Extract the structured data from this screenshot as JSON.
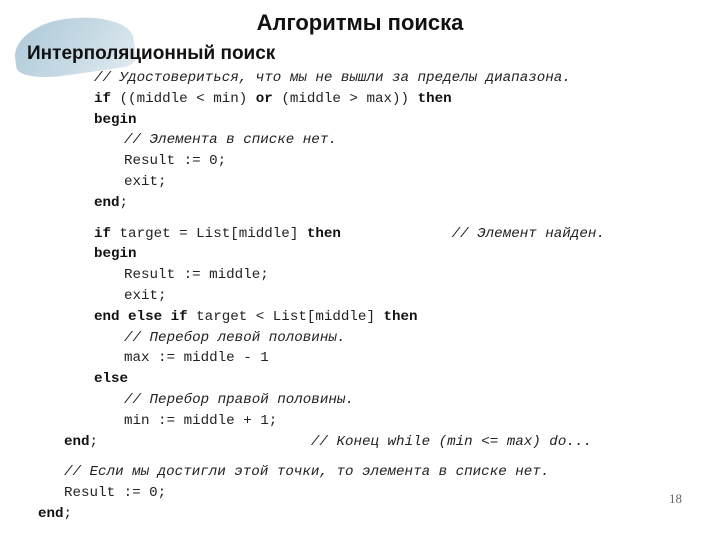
{
  "slide": {
    "title": "Алгоритмы поиска",
    "subtitle": "Интерполяционный поиск",
    "page_number": "18"
  },
  "code": [
    {
      "indent": 1,
      "segments": [
        {
          "t": "cm",
          "v": "// Удостовериться, что мы не вышли за пределы диапазона."
        }
      ]
    },
    {
      "indent": 1,
      "segments": [
        {
          "t": "kw",
          "v": "if"
        },
        {
          "t": "tx",
          "v": " ((middle < min) "
        },
        {
          "t": "kw",
          "v": "or"
        },
        {
          "t": "tx",
          "v": " (middle > max)) "
        },
        {
          "t": "kw",
          "v": "then"
        }
      ]
    },
    {
      "indent": 1,
      "segments": [
        {
          "t": "kw",
          "v": "begin"
        }
      ]
    },
    {
      "indent": 2,
      "segments": [
        {
          "t": "cm",
          "v": "// Элемента в списке нет."
        }
      ]
    },
    {
      "indent": 2,
      "segments": [
        {
          "t": "tx",
          "v": "Result := 0;"
        }
      ]
    },
    {
      "indent": 2,
      "segments": [
        {
          "t": "tx",
          "v": "exit;"
        }
      ]
    },
    {
      "indent": 1,
      "segments": [
        {
          "t": "kw",
          "v": "end"
        },
        {
          "t": "tx",
          "v": ";"
        }
      ]
    },
    {
      "indent": 1,
      "gap": true,
      "segments": [
        {
          "t": "kw",
          "v": "if"
        },
        {
          "t": "tx",
          "v": " target = List[middle] "
        },
        {
          "t": "kw",
          "v": "then"
        },
        {
          "t": "tx",
          "v": "             "
        },
        {
          "t": "cm",
          "v": "// Элемент найден."
        }
      ]
    },
    {
      "indent": 1,
      "segments": [
        {
          "t": "kw",
          "v": "begin"
        }
      ]
    },
    {
      "indent": 2,
      "segments": [
        {
          "t": "tx",
          "v": "Result := middle;"
        }
      ]
    },
    {
      "indent": 2,
      "segments": [
        {
          "t": "tx",
          "v": "exit;"
        }
      ]
    },
    {
      "indent": 1,
      "segments": [
        {
          "t": "kw",
          "v": "end else if"
        },
        {
          "t": "tx",
          "v": " target < List[middle] "
        },
        {
          "t": "kw",
          "v": "then"
        }
      ]
    },
    {
      "indent": 2,
      "segments": [
        {
          "t": "cm",
          "v": "// Перебор левой половины."
        }
      ]
    },
    {
      "indent": 2,
      "segments": [
        {
          "t": "tx",
          "v": "max := middle - 1"
        }
      ]
    },
    {
      "indent": 1,
      "segments": [
        {
          "t": "kw",
          "v": "else"
        }
      ]
    },
    {
      "indent": 2,
      "segments": [
        {
          "t": "cm",
          "v": "// Перебор правой половины."
        }
      ]
    },
    {
      "indent": 2,
      "segments": [
        {
          "t": "tx",
          "v": "min := middle + 1;"
        }
      ]
    },
    {
      "indent": 0,
      "segments": [
        {
          "t": "kw",
          "v": "end"
        },
        {
          "t": "tx",
          "v": ";                         "
        },
        {
          "t": "cm",
          "v": "// Конец while (min <= max) do..."
        }
      ]
    },
    {
      "indent": 0,
      "gap": true,
      "segments": [
        {
          "t": "cm",
          "v": "// Если мы достигли этой точки, то элемента в списке нет."
        }
      ]
    },
    {
      "indent": 0,
      "segments": [
        {
          "t": "tx",
          "v": "Result := 0;"
        }
      ]
    },
    {
      "indent": -1,
      "segments": [
        {
          "t": "kw",
          "v": "end"
        },
        {
          "t": "tx",
          "v": ";"
        }
      ]
    }
  ]
}
